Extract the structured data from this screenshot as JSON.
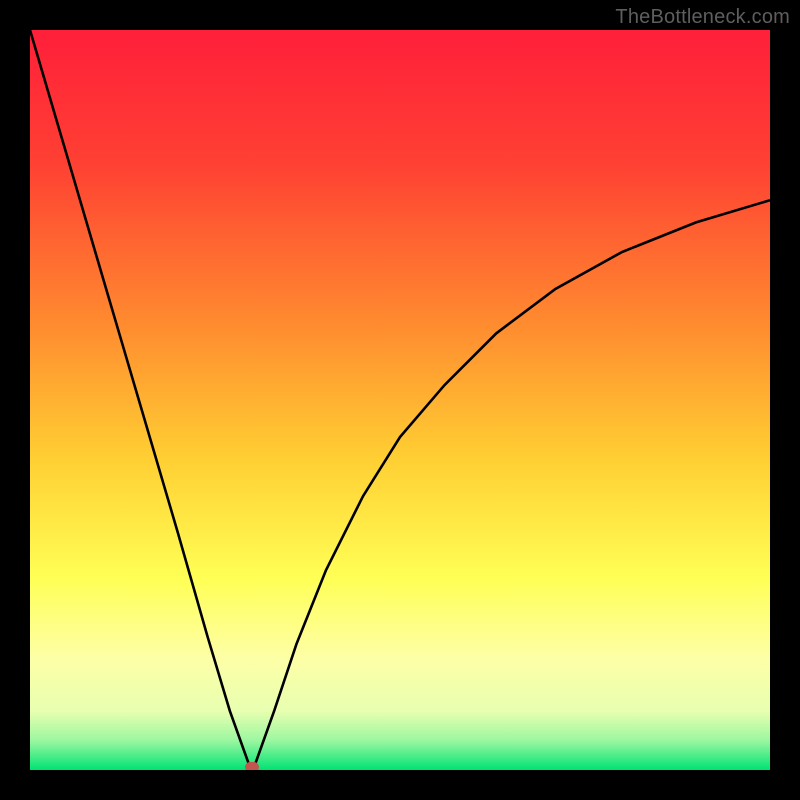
{
  "watermark": "TheBottleneck.com",
  "colors": {
    "black": "#000000",
    "red_top": "#ff1f3a",
    "orange_mid": "#ffa531",
    "yellow_low": "#ffff66",
    "pale_yellow": "#fffdb0",
    "green_bottom": "#00e374",
    "curve": "#000000",
    "dot": "#c0564d",
    "watermark": "#5e5e5e"
  },
  "chart_data": {
    "type": "line",
    "title": "",
    "xlabel": "",
    "ylabel": "",
    "xlim": [
      0,
      100
    ],
    "ylim": [
      0,
      100
    ],
    "min_point": {
      "x": 30,
      "y": 0
    },
    "series": [
      {
        "name": "curve",
        "x": [
          0,
          5,
          10,
          15,
          20,
          24,
          27,
          29.5,
          30,
          30.5,
          33,
          36,
          40,
          45,
          50,
          56,
          63,
          71,
          80,
          90,
          100
        ],
        "y": [
          100,
          83,
          66,
          49,
          32,
          18,
          8,
          1,
          0,
          1,
          8,
          17,
          27,
          37,
          45,
          52,
          59,
          65,
          70,
          74,
          77
        ]
      }
    ],
    "annotations": [
      {
        "name": "min-marker",
        "x": 30,
        "y": 0
      }
    ]
  },
  "gradient_stops": [
    {
      "offset": 0,
      "color": "#ff1f3a"
    },
    {
      "offset": 18,
      "color": "#ff4033"
    },
    {
      "offset": 40,
      "color": "#ff8c2f"
    },
    {
      "offset": 58,
      "color": "#ffcf33"
    },
    {
      "offset": 74,
      "color": "#ffff55"
    },
    {
      "offset": 85,
      "color": "#fdffa6"
    },
    {
      "offset": 92,
      "color": "#e8ffb0"
    },
    {
      "offset": 96,
      "color": "#9cf7a0"
    },
    {
      "offset": 100,
      "color": "#00e374"
    }
  ]
}
